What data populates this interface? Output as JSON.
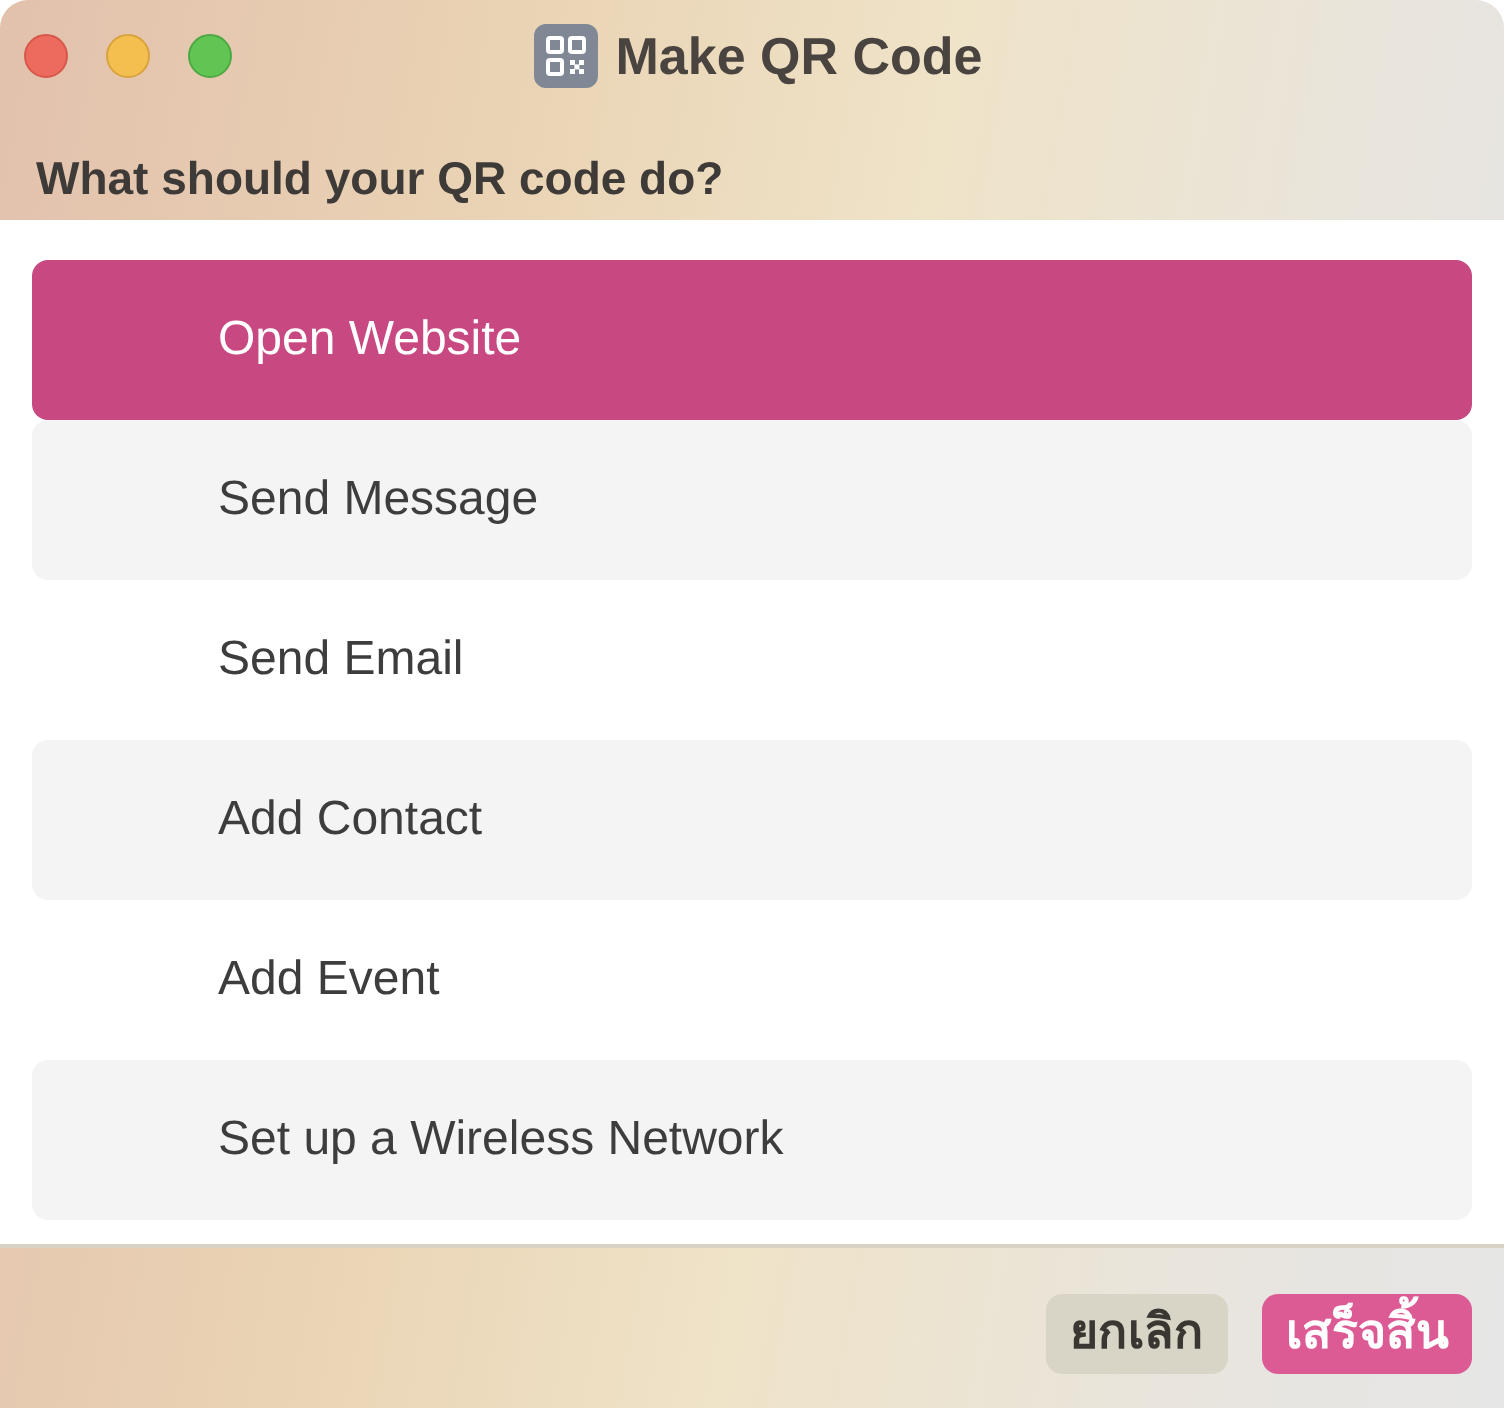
{
  "window": {
    "title": "Make QR Code"
  },
  "prompt": "What should your QR code do?",
  "options": [
    {
      "label": "Open Website",
      "selected": true
    },
    {
      "label": "Send Message",
      "selected": false
    },
    {
      "label": "Send Email",
      "selected": false
    },
    {
      "label": "Add Contact",
      "selected": false
    },
    {
      "label": "Add Event",
      "selected": false
    },
    {
      "label": "Set up a Wireless Network",
      "selected": false
    }
  ],
  "buttons": [
    {
      "label": "ยกเลิก",
      "kind": "secondary"
    },
    {
      "label": "เสร็จสิ้น",
      "kind": "primary"
    }
  ]
}
